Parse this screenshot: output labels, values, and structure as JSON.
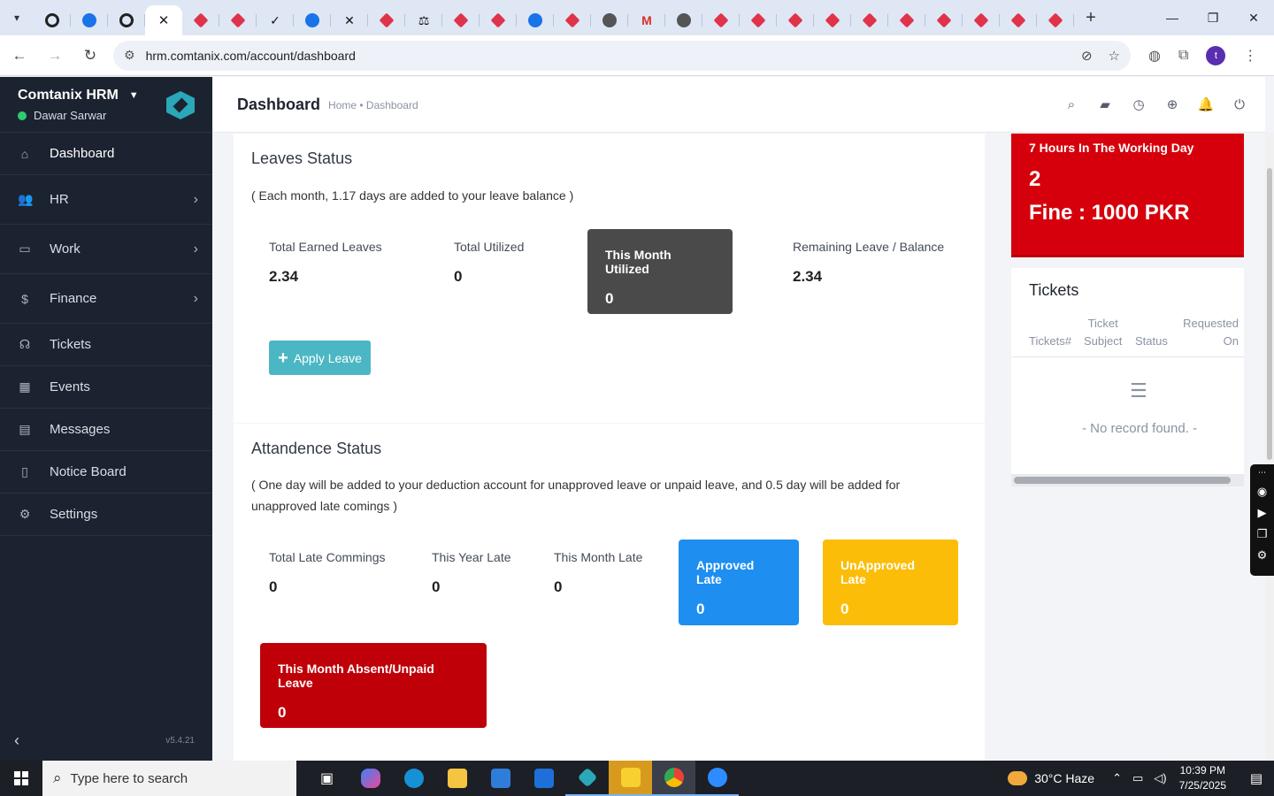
{
  "browser": {
    "active_tab_close": "✕",
    "new_tab": "+",
    "url": "hrm.comtanix.com/account/dashboard",
    "profile_initial": "t"
  },
  "sidebar": {
    "brand": "Comtanix HRM",
    "user": "Dawar Sarwar",
    "items": [
      {
        "label": "Dashboard",
        "icon": "home-icon",
        "has_children": false
      },
      {
        "label": "HR",
        "icon": "users-icon",
        "has_children": true
      },
      {
        "label": "Work",
        "icon": "briefcase-icon",
        "has_children": true
      },
      {
        "label": "Finance",
        "icon": "dollar-icon",
        "has_children": true
      },
      {
        "label": "Tickets",
        "icon": "headset-icon",
        "has_children": false
      },
      {
        "label": "Events",
        "icon": "calendar-icon",
        "has_children": false
      },
      {
        "label": "Messages",
        "icon": "message-icon",
        "has_children": false
      },
      {
        "label": "Notice Board",
        "icon": "clipboard-icon",
        "has_children": false
      },
      {
        "label": "Settings",
        "icon": "gear-icon",
        "has_children": false
      }
    ],
    "version": "v5.4.21"
  },
  "header": {
    "title": "Dashboard",
    "breadcrumb": "Home • Dashboard"
  },
  "leaves": {
    "title": "Leaves Status",
    "note": "( Each month, 1.17 days are added to your leave balance )",
    "stats": [
      {
        "label": "Total Earned Leaves",
        "value": "2.34"
      },
      {
        "label": "Total Utilized",
        "value": "0"
      },
      {
        "label": "This Month Utilized",
        "value": "0"
      },
      {
        "label": "Remaining Leave / Balance",
        "value": "2.34"
      }
    ],
    "apply_button": "Apply Leave"
  },
  "attendance": {
    "title": "Attandence Status",
    "note_line1": "( One day will be added to your deduction account for unapproved leave or unpaid leave, and 0.5 day will be added for",
    "note_line2": "unapproved late comings )",
    "stats": [
      {
        "label": "Total Late Commings",
        "value": "0"
      },
      {
        "label": "This Year Late",
        "value": "0"
      },
      {
        "label": "This Month Late",
        "value": "0"
      },
      {
        "label": "Approved Late",
        "value": "0"
      },
      {
        "label": "UnApproved Late",
        "value": "0"
      },
      {
        "label": "This Month Absent/Unpaid Leave",
        "value": "0"
      }
    ]
  },
  "working_day": {
    "title": "7 Hours In The Working Day",
    "count": "2",
    "fine": "Fine : 1000 PKR"
  },
  "tickets": {
    "title": "Tickets",
    "col_number": "Tickets#",
    "col_subject_1": "Ticket",
    "col_subject_2": "Subject",
    "col_status": "Status",
    "col_requested_1": "Requested",
    "col_requested_2": "On",
    "empty": "- No record found. -"
  },
  "taskbar": {
    "search_placeholder": "Type here to search",
    "weather": "30°C  Haze",
    "time": "10:39 PM",
    "date": "7/25/2025"
  },
  "colors": {
    "sidebar_bg": "#1c2330",
    "teal": "#4cb7c4",
    "dark_box": "#4a4a4a",
    "blue_box": "#1e8ef0",
    "yellow_box": "#fbbd08",
    "red_box": "#bf0008",
    "red_card": "#d6000c"
  }
}
